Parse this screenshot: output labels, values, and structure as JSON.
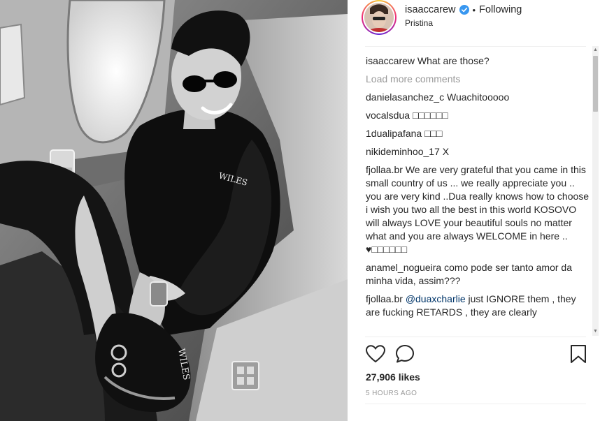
{
  "post": {
    "username": "isaaccarew",
    "following_label": "Following",
    "separator": "•",
    "location": "Pristina",
    "likes": "27,906 likes",
    "time": "5 HOURS AGO",
    "photo_shirt_text": "WILES"
  },
  "comments": {
    "caption": {
      "user": "isaaccarew",
      "text": "What are those?"
    },
    "load_more": "Load more comments",
    "items": [
      {
        "user": "danielasanchez_c",
        "text": "Wuachitooooo"
      },
      {
        "user": "vocalsdua",
        "text": "□□□□□□"
      },
      {
        "user": "1dualipafana",
        "text": "□□□"
      },
      {
        "user": "nikideminhoo_17",
        "text": "X"
      },
      {
        "user": "fjollaa.br",
        "text": "We are very grateful that you came in this small country of us ... we really appreciate you .. you are very kind ..Dua really knows how to choose i wish you two all the best in this world KOSOVO will always LOVE your beautiful souls no matter what and you are always WELCOME in here .. ♥□□□□□□"
      },
      {
        "user": "anamel_nogueira",
        "text": "como pode ser tanto amor da minha vida, assim???"
      },
      {
        "user": "fjollaa.br",
        "mention": "@duaxcharlie",
        "text": "just IGNORE them , they are fucking RETARDS , they are clearly"
      }
    ]
  },
  "icons": {
    "like": "heart-icon",
    "comment": "comment-bubble-icon",
    "save": "bookmark-icon",
    "verified": "verified-badge-icon"
  },
  "colors": {
    "verified": "#3897f0",
    "text": "#262626",
    "muted": "#999999",
    "mention": "#003569",
    "divider": "#efefef"
  }
}
